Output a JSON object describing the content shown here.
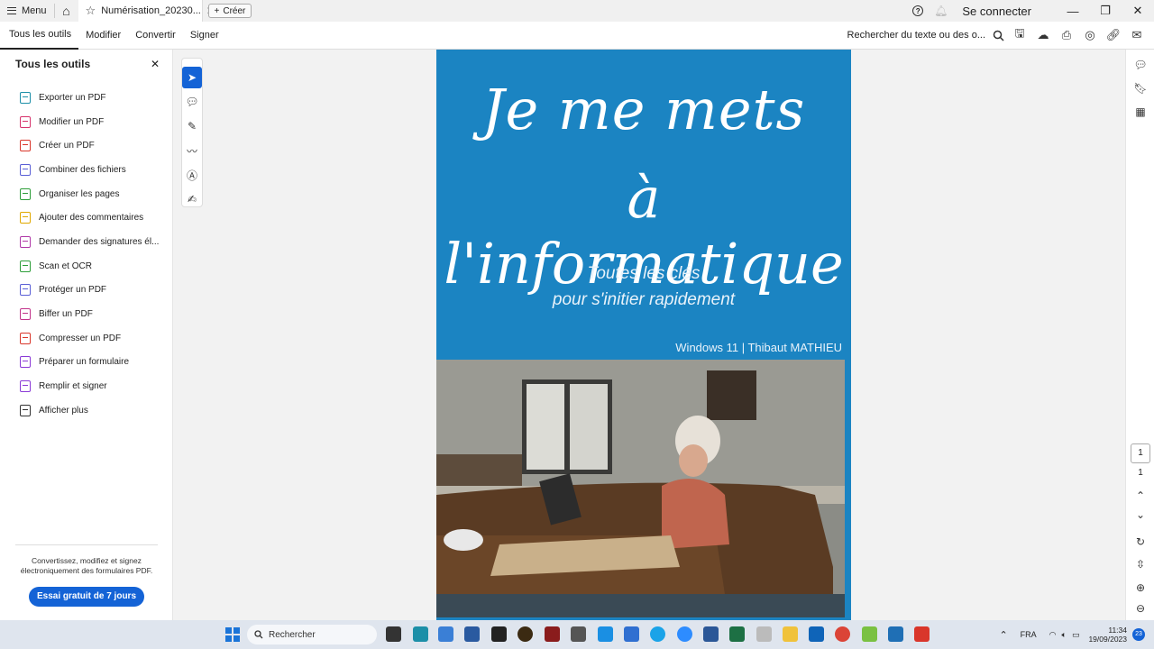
{
  "titlebar": {
    "menu_label": "Menu",
    "tab_title": "Numérisation_20230...",
    "new_label": "Créer",
    "signin_label": "Se connecter"
  },
  "toolbar": {
    "tabs": [
      "Tous les outils",
      "Modifier",
      "Convertir",
      "Signer"
    ],
    "search_placeholder": "Rechercher du texte ou des o..."
  },
  "left_panel": {
    "title": "Tous les outils",
    "items": [
      {
        "label": "Exporter un PDF",
        "icon": "export-pdf-icon",
        "color": "#1c8fa8"
      },
      {
        "label": "Modifier un PDF",
        "icon": "edit-pdf-icon",
        "color": "#d6336c"
      },
      {
        "label": "Créer un PDF",
        "icon": "create-pdf-icon",
        "color": "#d9362b"
      },
      {
        "label": "Combiner des fichiers",
        "icon": "combine-files-icon",
        "color": "#5a5fd6"
      },
      {
        "label": "Organiser les pages",
        "icon": "organize-pages-icon",
        "color": "#2e9e3a"
      },
      {
        "label": "Ajouter des commentaires",
        "icon": "comment-icon",
        "color": "#e0a800"
      },
      {
        "label": "Demander des signatures él...",
        "icon": "request-signature-icon",
        "color": "#b03aa8"
      },
      {
        "label": "Scan et OCR",
        "icon": "scan-ocr-icon",
        "color": "#2e9e3a"
      },
      {
        "label": "Protéger un PDF",
        "icon": "protect-pdf-icon",
        "color": "#5a5fd6"
      },
      {
        "label": "Biffer un PDF",
        "icon": "redact-pdf-icon",
        "color": "#c2338a"
      },
      {
        "label": "Compresser un PDF",
        "icon": "compress-pdf-icon",
        "color": "#d9362b"
      },
      {
        "label": "Préparer un formulaire",
        "icon": "prepare-form-icon",
        "color": "#8a3ad6"
      },
      {
        "label": "Remplir et signer",
        "icon": "fill-sign-icon",
        "color": "#8a3ad6"
      },
      {
        "label": "Afficher plus",
        "icon": "tools-icon",
        "color": "#333333"
      }
    ],
    "footer_text": "Convertissez, modifiez et signez électroniquement des formulaires PDF.",
    "trial_button": "Essai gratuit de 7 jours"
  },
  "document": {
    "title_line1": "Je me mets",
    "title_line2": "à l'informatique",
    "subtitle_line1": "Toutes les clés",
    "subtitle_line2": "pour s'initier rapidement",
    "author_line": "Windows 11 | Thibaut MATHIEU",
    "cover_color": "#1b84c2"
  },
  "right_panel": {
    "current_page": "1",
    "total_pages": "1"
  },
  "taskbar": {
    "search_placeholder": "Rechercher",
    "language": "FRA",
    "time": "11:34",
    "date": "19/09/2023",
    "notification_count": "23"
  }
}
